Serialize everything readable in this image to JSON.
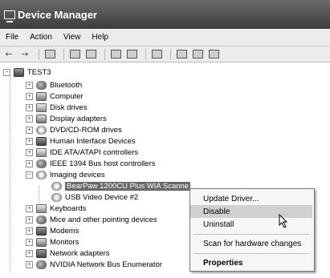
{
  "window": {
    "title": "Device Manager"
  },
  "menu": [
    "File",
    "Action",
    "View",
    "Help"
  ],
  "toolbar": {
    "icons": [
      "back-arrow-icon",
      "forward-arrow-icon",
      "console-tree-icon",
      "properties-icon",
      "print-icon",
      "help-icon",
      "view-icon",
      "scan-hardware-icon",
      "update-driver-icon",
      "uninstall-icon",
      "disable-icon"
    ]
  },
  "tree": {
    "root": "TEST3",
    "items": [
      "Bluetooth",
      "Computer",
      "Disk drives",
      "Display adapters",
      "DVD/CD-ROM drives",
      "Human Interface Devices",
      "IDE ATA/ATAPI controllers",
      "IEEE 1394 Bus host controllers",
      "Imaging devices",
      "Keyboards",
      "Mice and other pointing devices",
      "Modems",
      "Monitors",
      "Network adapters",
      "NVIDIA Network Bus Enumerator"
    ],
    "imaging_children": [
      "BearPaw 1200CU Plus WIA Scanne",
      "USB Video Device #2"
    ]
  },
  "context_menu": {
    "items": [
      "Update Driver...",
      "Disable",
      "Uninstall",
      "Scan for hardware changes",
      "Properties"
    ]
  }
}
